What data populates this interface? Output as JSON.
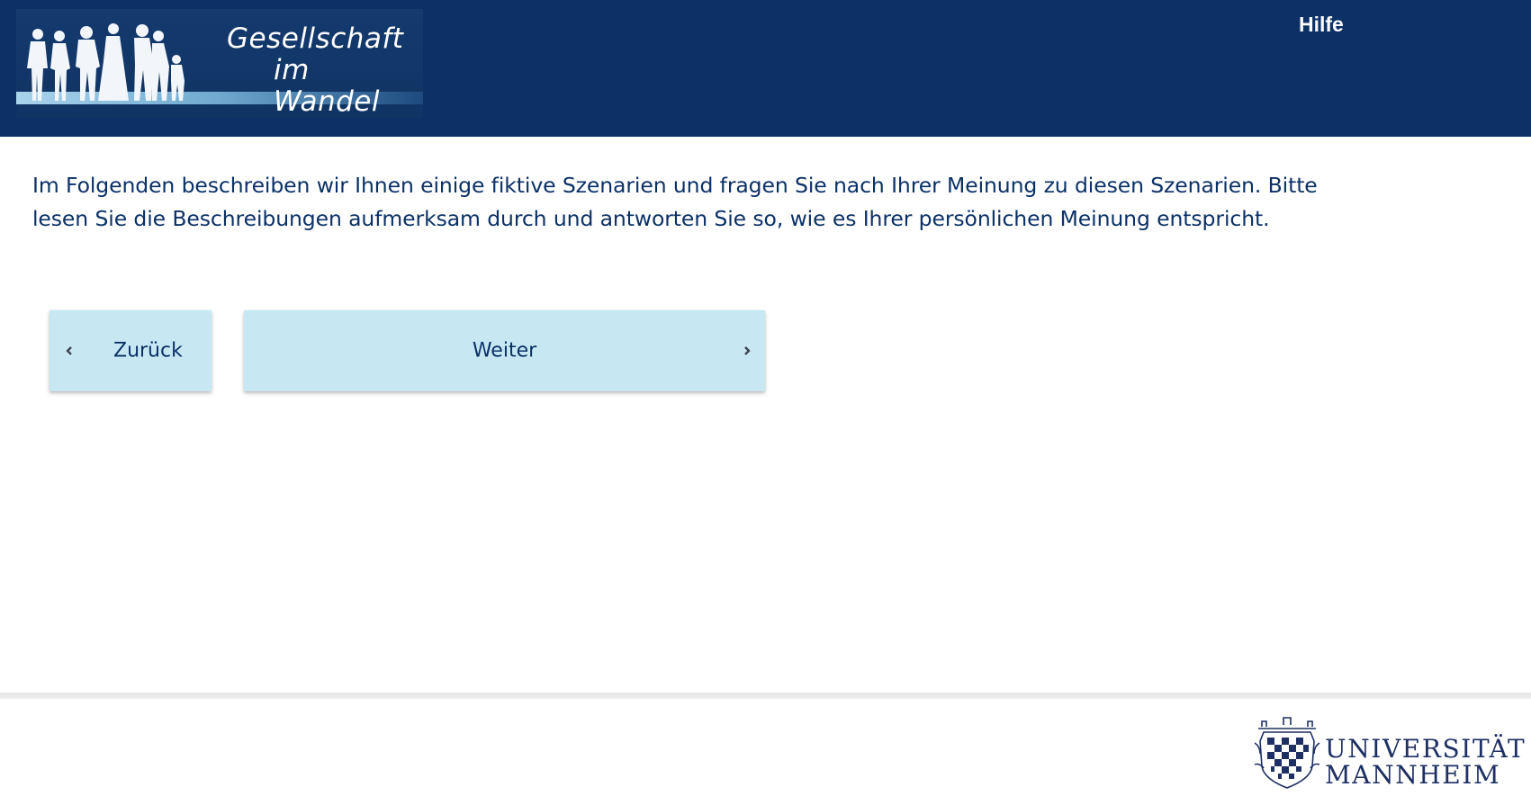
{
  "header": {
    "logo": {
      "line1": "Gesellschaft",
      "line2": "im Wandel"
    },
    "help_link": "Hilfe"
  },
  "main": {
    "intro_text": "Im Folgenden beschreiben wir Ihnen einige fiktive Szenarien und fragen Sie nach Ihrer Meinung zu diesen Szenarien. Bitte lesen Sie die Beschreibungen aufmerksam durch und antworten Sie so, wie es Ihrer persönlichen Meinung entspricht.",
    "buttons": {
      "back_label": "Zurück",
      "next_label": "Weiter"
    }
  },
  "footer": {
    "university": {
      "line1": "UNIVERSITÄT",
      "line2": "MANNHEIM"
    }
  },
  "colors": {
    "header_bg": "#0b3166",
    "text": "#0b3166",
    "button_bg": "#c7e8f3",
    "university_blue": "#1e2f63"
  },
  "icons": {
    "back": "chevron-left-icon",
    "next": "chevron-right-icon"
  }
}
